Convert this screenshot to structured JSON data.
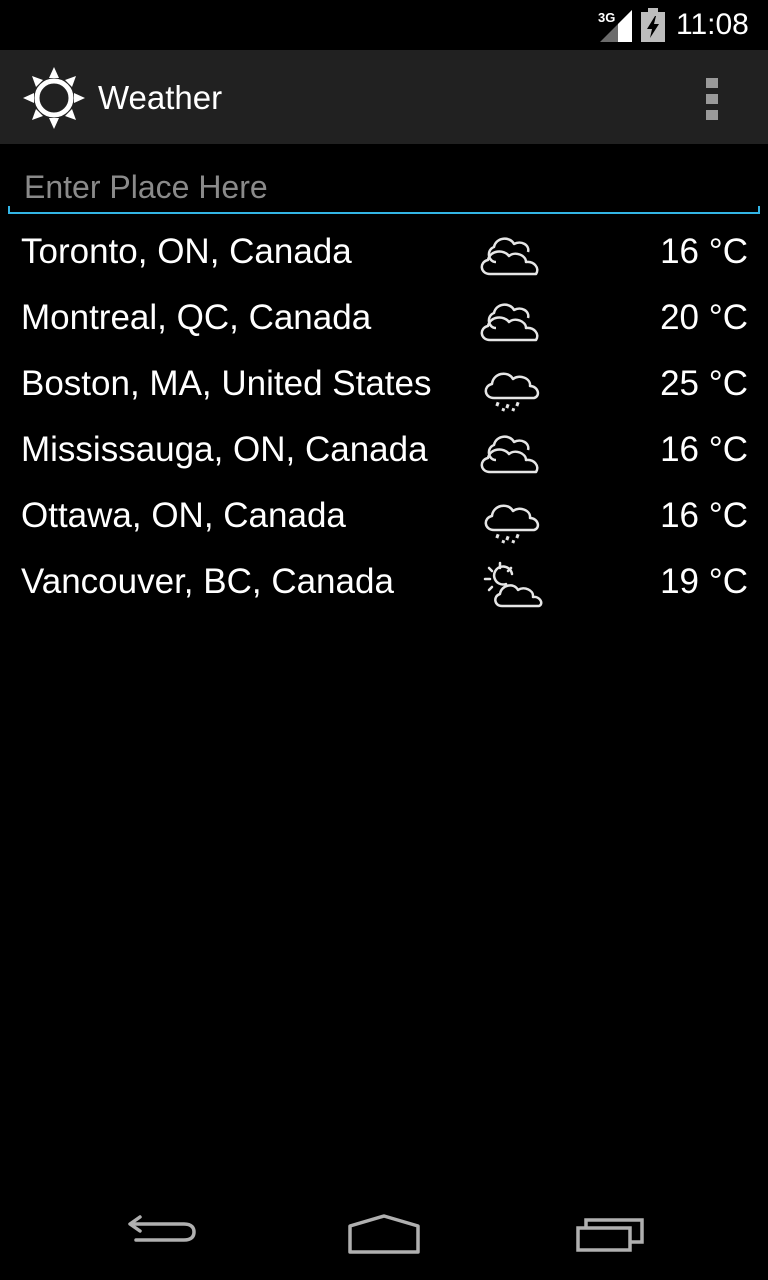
{
  "status_bar": {
    "network_label": "3G",
    "time": "11:08"
  },
  "action_bar": {
    "title": "Weather",
    "app_icon": "sun-icon",
    "overflow_icon": "overflow-menu-icon"
  },
  "search": {
    "placeholder": "Enter Place Here",
    "value": "",
    "accent_color": "#33b5e5"
  },
  "places": [
    {
      "name": "Toronto, ON, Canada",
      "icon": "cloudy-icon",
      "temperature": "16 °C"
    },
    {
      "name": "Montreal, QC, Canada",
      "icon": "cloudy-icon",
      "temperature": "20 °C"
    },
    {
      "name": "Boston, MA, United States",
      "icon": "rain-icon",
      "temperature": "25 °C"
    },
    {
      "name": "Mississauga, ON, Canada",
      "icon": "cloudy-icon",
      "temperature": "16 °C"
    },
    {
      "name": "Ottawa, ON, Canada",
      "icon": "rain-icon",
      "temperature": "16 °C"
    },
    {
      "name": "Vancouver, BC, Canada",
      "icon": "partly-sunny-icon",
      "temperature": "19 °C"
    }
  ],
  "nav_bar": {
    "back_icon": "back-icon",
    "home_icon": "home-icon",
    "recents_icon": "recent-apps-icon"
  }
}
